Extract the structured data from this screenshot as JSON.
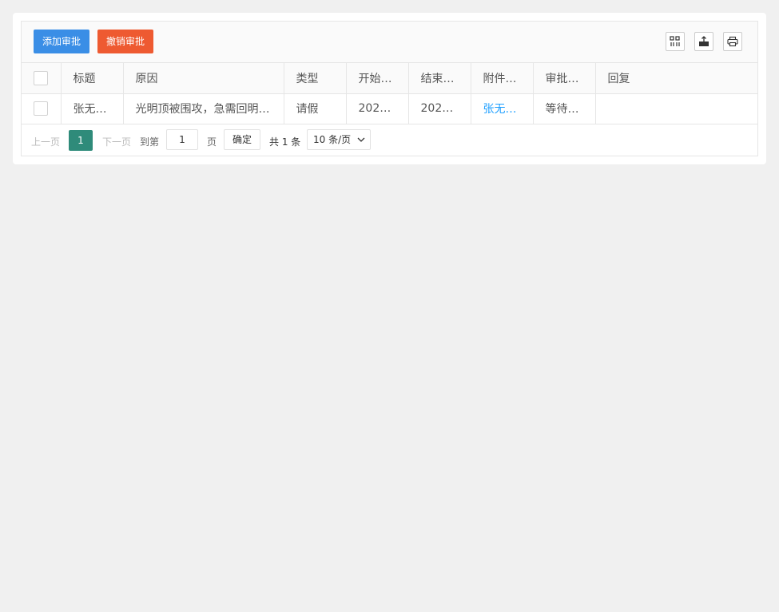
{
  "toolbar": {
    "add_label": "添加审批",
    "revoke_label": "撤销审批",
    "icons": [
      "columns-icon",
      "export-icon",
      "print-icon"
    ],
    "add_color": "#3a8ee6",
    "revoke_color": "#ee5a31"
  },
  "table": {
    "headers": [
      "标题",
      "原因",
      "类型",
      "开始…",
      "结束…",
      "附件(…",
      "审批…",
      "回复"
    ],
    "rows": [
      [
        "张无…",
        "光明顶被围攻，急需回明…",
        "请假",
        "2021…",
        "2021…",
        "张无…",
        "等待…",
        ""
      ]
    ]
  },
  "pager": {
    "prev": "上一页",
    "current": "1",
    "next": "下一页",
    "goto": "到第",
    "input_value": "1",
    "page": "页",
    "confirm": "确定",
    "total": "共 1 条",
    "page_size": "10 条/页",
    "active_color": "#2f8b7a"
  }
}
